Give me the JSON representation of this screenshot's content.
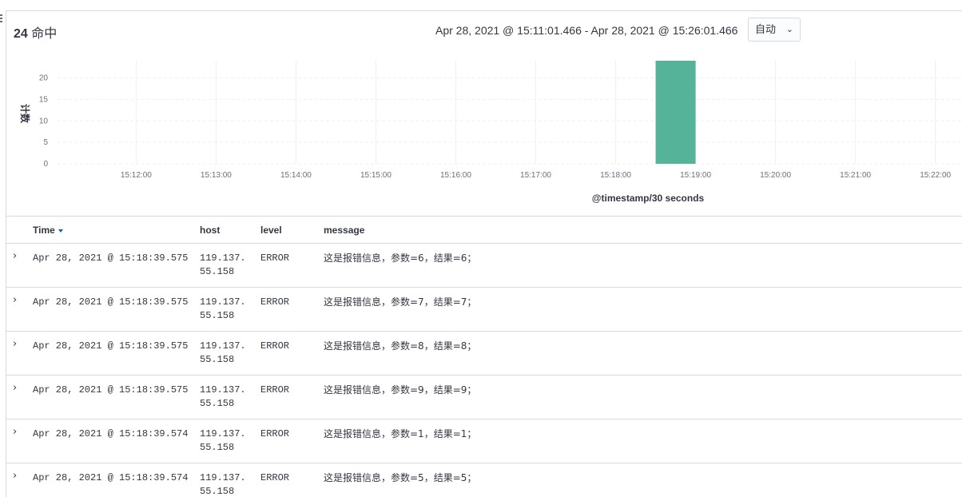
{
  "hits": {
    "count": "24",
    "label": "命中"
  },
  "time_range": "Apr 28, 2021 @ 15:11:01.466 - Apr 28, 2021 @ 15:26:01.466",
  "interval": {
    "selected": "自动",
    "icon": "chevron-down-icon"
  },
  "chart_data": {
    "type": "bar",
    "ylabel": "计数",
    "xlabel": "@timestamp/30 seconds",
    "yticks": [
      0,
      5,
      10,
      15,
      20
    ],
    "ylim": [
      0,
      24
    ],
    "xticks": [
      "15:12:00",
      "15:13:00",
      "15:14:00",
      "15:15:00",
      "15:16:00",
      "15:17:00",
      "15:18:00",
      "15:19:00",
      "15:20:00",
      "15:21:00",
      "15:22:00"
    ],
    "xlim": [
      "15:11:01",
      "15:22:20"
    ],
    "bars": [
      {
        "start": "15:18:30",
        "end": "15:19:00",
        "value": 24
      }
    ],
    "grid": true,
    "color": "#54b399"
  },
  "table": {
    "columns": {
      "time": "Time",
      "host": "host",
      "level": "level",
      "message": "message"
    },
    "rows": [
      {
        "time": "Apr 28, 2021 @ 15:18:39.575",
        "host1": "119.137.",
        "host2": "55.158",
        "level": "ERROR",
        "message": "这是报错信息，参数=6，结果=6；"
      },
      {
        "time": "Apr 28, 2021 @ 15:18:39.575",
        "host1": "119.137.",
        "host2": "55.158",
        "level": "ERROR",
        "message": "这是报错信息，参数=7，结果=7；"
      },
      {
        "time": "Apr 28, 2021 @ 15:18:39.575",
        "host1": "119.137.",
        "host2": "55.158",
        "level": "ERROR",
        "message": "这是报错信息，参数=8，结果=8；"
      },
      {
        "time": "Apr 28, 2021 @ 15:18:39.575",
        "host1": "119.137.",
        "host2": "55.158",
        "level": "ERROR",
        "message": "这是报错信息，参数=9，结果=9；"
      },
      {
        "time": "Apr 28, 2021 @ 15:18:39.574",
        "host1": "119.137.",
        "host2": "55.158",
        "level": "ERROR",
        "message": "这是报错信息，参数=1，结果=1；"
      },
      {
        "time": "Apr 28, 2021 @ 15:18:39.574",
        "host1": "119.137.",
        "host2": "55.158",
        "level": "ERROR",
        "message": "这是报错信息，参数=5，结果=5；"
      }
    ]
  }
}
